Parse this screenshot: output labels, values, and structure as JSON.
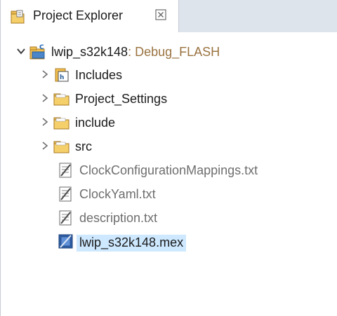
{
  "view": {
    "tab_label": "Project Explorer"
  },
  "tree": {
    "project": {
      "name": "lwip_s32k148",
      "decoration": ": Debug_FLASH",
      "expanded": true
    },
    "folders": [
      {
        "label": "Includes",
        "icon": "includes-icon"
      },
      {
        "label": "Project_Settings",
        "icon": "folder-icon"
      },
      {
        "label": "include",
        "icon": "folder-icon"
      },
      {
        "label": "src",
        "icon": "folder-icon"
      }
    ],
    "files": [
      {
        "label": "ClockConfigurationMappings.txt",
        "icon": "text-file-icon"
      },
      {
        "label": "ClockYaml.txt",
        "icon": "text-file-icon"
      },
      {
        "label": "description.txt",
        "icon": "text-file-icon"
      },
      {
        "label": "lwip_s32k148.mex",
        "icon": "mex-file-icon",
        "selected": true
      }
    ]
  },
  "colors": {
    "selection": "#cde8ff",
    "tab_bar": "#dde4ec",
    "decoration": "#9a7340",
    "gray_text": "#6e6e6e"
  }
}
